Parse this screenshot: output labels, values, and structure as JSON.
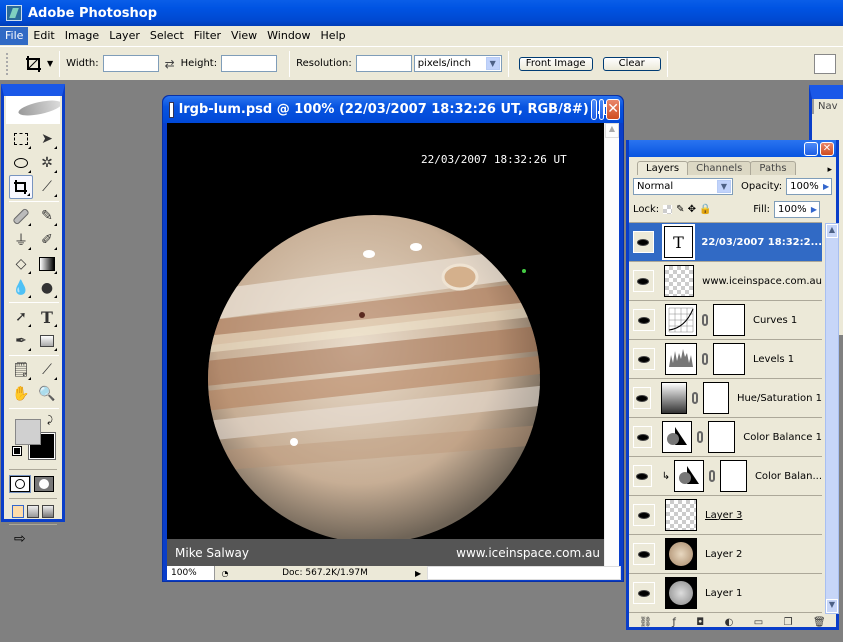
{
  "app": {
    "title": "Adobe Photoshop"
  },
  "menu": [
    "File",
    "Edit",
    "Image",
    "Layer",
    "Select",
    "Filter",
    "View",
    "Window",
    "Help"
  ],
  "options_bar": {
    "width_label": "Width:",
    "width_value": "",
    "swap_icon": "swap-arrows-icon",
    "height_label": "Height:",
    "height_value": "",
    "resolution_label": "Resolution:",
    "resolution_value": "",
    "units": "pixels/inch",
    "front_image_label": "Front Image",
    "clear_label": "Clear"
  },
  "toolbox": {
    "tools": [
      "marquee",
      "move",
      "lasso",
      "magic-wand",
      "crop",
      "slice",
      "healing-brush",
      "brush",
      "clone-stamp",
      "history-brush",
      "eraser",
      "gradient",
      "blur",
      "dodge",
      "path-selection",
      "type",
      "pen",
      "shape",
      "notes",
      "eyedropper",
      "hand",
      "zoom"
    ],
    "selected": "crop",
    "foreground_color": "#d0d0d0",
    "background_color": "#000000"
  },
  "document": {
    "title": "lrgb-lum.psd @ 100% (22/03/2007 18:32:26 UT, RGB/8#)",
    "overlay_timestamp": "22/03/2007 18:32:26 UT",
    "caption_left": "Mike Salway",
    "caption_right": "www.iceinspace.com.au",
    "zoom": "100%",
    "doc_info": "Doc: 567.2K/1.97M"
  },
  "layers_panel": {
    "tabs": [
      "Layers",
      "Channels",
      "Paths"
    ],
    "active_tab": "Layers",
    "blend_mode": "Normal",
    "opacity_label": "Opacity:",
    "opacity": "100%",
    "lock_label": "Lock:",
    "fill_label": "Fill:",
    "fill": "100%",
    "layers": [
      {
        "name": "22/03/2007 18:32:2...",
        "type": "text",
        "selected": true
      },
      {
        "name": "www.iceinspace.com.au",
        "type": "transparent"
      },
      {
        "name": "Curves 1",
        "type": "curves"
      },
      {
        "name": "Levels 1",
        "type": "levels"
      },
      {
        "name": "Hue/Saturation 1",
        "type": "huesat"
      },
      {
        "name": "Color Balance 1",
        "type": "colorbalance"
      },
      {
        "name": "Color Balan...",
        "type": "colorbalance",
        "clipped": true
      },
      {
        "name": "Layer 3",
        "type": "transparent"
      },
      {
        "name": "Layer 2",
        "type": "image"
      },
      {
        "name": "Layer 1",
        "type": "image"
      }
    ]
  },
  "navigator_panel": {
    "tab": "Nav"
  }
}
